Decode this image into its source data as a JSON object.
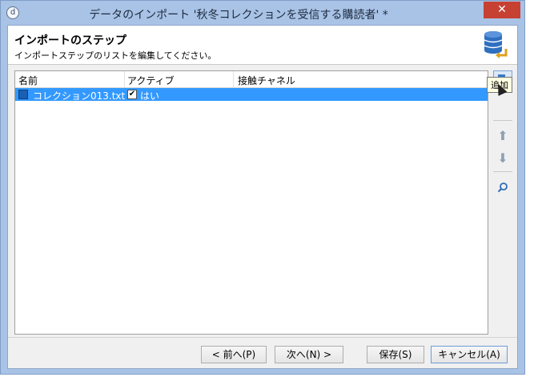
{
  "window": {
    "title": "データのインポート '秋冬コレクションを受信する購読者' *",
    "app_icon_glyph": "d",
    "close_glyph": "✕"
  },
  "header": {
    "title": "インポートのステップ",
    "subtitle": "インポートステップのリストを編集してください。",
    "icon": "database-import-icon"
  },
  "table": {
    "columns": [
      "名前",
      "アクティブ",
      "接触チャネル"
    ],
    "rows": [
      {
        "name": "コレクション013.txt",
        "active_checked": true,
        "active_label": "はい",
        "channel": ""
      }
    ]
  },
  "toolbar": {
    "add_icon": "add-step-icon",
    "up_icon": "arrow-up-icon",
    "down_icon": "arrow-down-icon",
    "search_icon": "search-icon",
    "tooltip": "追加"
  },
  "footer": {
    "prev": "< 前へ(P)",
    "next": "次へ(N) >",
    "save": "保存(S)",
    "cancel": "キャンセル(A)"
  },
  "colors": {
    "selection": "#3399ff",
    "close": "#c74133",
    "frame": "#a9c3e6"
  }
}
